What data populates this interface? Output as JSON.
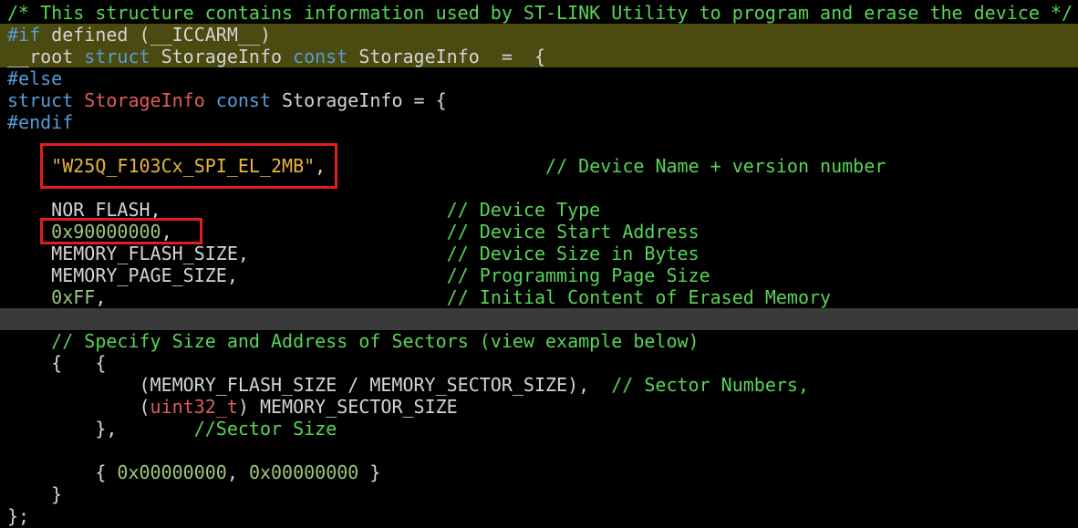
{
  "editor": {
    "theme_colors": {
      "background": "#000000",
      "comment": "#57d457",
      "keyword": "#569cd6",
      "type_name": "#e05b5b",
      "string": "#e8b23a",
      "number": "#9cc780",
      "text": "#d4d4d4",
      "highlight_line": "#4b4a10",
      "current_line": "#3a3a3a",
      "annotation_box": "#e01e1e"
    },
    "lines": [
      [
        {
          "t": "/* This structure contains information used by ST-LINK Utility to program and erase the device */",
          "c": "comment"
        }
      ],
      [
        {
          "t": "#if",
          "c": "pre"
        },
        {
          "t": " defined (__ICCARM__)",
          "c": "plain"
        }
      ],
      [
        {
          "t": "__root ",
          "c": "plain"
        },
        {
          "t": "struct",
          "c": "kw"
        },
        {
          "t": " StorageInfo ",
          "c": "plain"
        },
        {
          "t": "const",
          "c": "kw"
        },
        {
          "t": " StorageInfo  =  {",
          "c": "plain"
        }
      ],
      [
        {
          "t": "#else",
          "c": "pre"
        }
      ],
      [
        {
          "t": "struct",
          "c": "kw"
        },
        {
          "t": " ",
          "c": "plain"
        },
        {
          "t": "StorageInfo",
          "c": "type"
        },
        {
          "t": " ",
          "c": "plain"
        },
        {
          "t": "const",
          "c": "kw"
        },
        {
          "t": " StorageInfo = {",
          "c": "plain"
        }
      ],
      [
        {
          "t": "#endif",
          "c": "pre"
        }
      ],
      [],
      [
        {
          "t": "    ",
          "c": "plain"
        },
        {
          "t": "\"W25Q_F103Cx_SPI_EL_2MB\"",
          "c": "string"
        },
        {
          "t": ",                    ",
          "c": "plain"
        },
        {
          "t": "// Device Name + version number",
          "c": "comment"
        }
      ],
      [],
      [
        {
          "t": "    NOR_FLASH,                          ",
          "c": "plain"
        },
        {
          "t": "// Device Type",
          "c": "comment"
        }
      ],
      [
        {
          "t": "    ",
          "c": "plain"
        },
        {
          "t": "0x90000000",
          "c": "num"
        },
        {
          "t": ",                         ",
          "c": "plain"
        },
        {
          "t": "// Device Start Address",
          "c": "comment"
        }
      ],
      [
        {
          "t": "    MEMORY_FLASH_SIZE,                  ",
          "c": "plain"
        },
        {
          "t": "// Device Size in Bytes",
          "c": "comment"
        }
      ],
      [
        {
          "t": "    MEMORY_PAGE_SIZE,                   ",
          "c": "plain"
        },
        {
          "t": "// Programming Page Size",
          "c": "comment"
        }
      ],
      [
        {
          "t": "    ",
          "c": "plain"
        },
        {
          "t": "0xFF",
          "c": "num"
        },
        {
          "t": ",                               ",
          "c": "plain"
        },
        {
          "t": "// Initial Content of Erased Memory",
          "c": "comment"
        }
      ],
      [],
      [
        {
          "t": "    ",
          "c": "plain"
        },
        {
          "t": "// Specify Size and Address of Sectors (view example below)",
          "c": "comment"
        }
      ],
      [
        {
          "t": "    {   {",
          "c": "plain"
        }
      ],
      [
        {
          "t": "            (MEMORY_FLASH_SIZE / MEMORY_SECTOR_SIZE),  ",
          "c": "plain"
        },
        {
          "t": "// Sector Numbers,",
          "c": "comment"
        }
      ],
      [
        {
          "t": "            (",
          "c": "plain"
        },
        {
          "t": "uint32_t",
          "c": "type"
        },
        {
          "t": ") MEMORY_SECTOR_SIZE",
          "c": "plain"
        }
      ],
      [
        {
          "t": "        },       ",
          "c": "plain"
        },
        {
          "t": "//Sector Size",
          "c": "comment"
        }
      ],
      [],
      [
        {
          "t": "        { ",
          "c": "plain"
        },
        {
          "t": "0x00000000",
          "c": "num"
        },
        {
          "t": ", ",
          "c": "plain"
        },
        {
          "t": "0x00000000",
          "c": "num"
        },
        {
          "t": " }",
          "c": "plain"
        }
      ],
      [
        {
          "t": "    }",
          "c": "plain"
        }
      ],
      [
        {
          "t": "};",
          "c": "plain"
        }
      ]
    ]
  }
}
